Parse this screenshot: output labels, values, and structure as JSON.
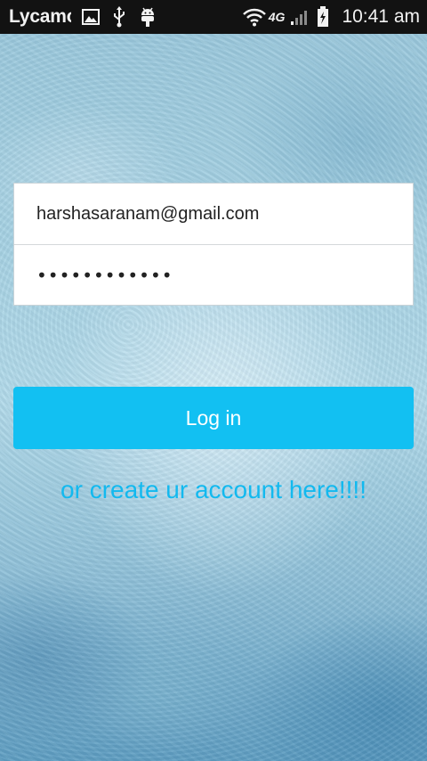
{
  "status_bar": {
    "carrier": "Lycamo",
    "network_type": "4G",
    "time": "10:41 am",
    "icons": [
      "gallery-icon",
      "usb-icon",
      "android-debug-icon",
      "wifi-icon",
      "signal-icon",
      "battery-charging-icon"
    ]
  },
  "login_form": {
    "email_value": "harshasaranam@gmail.com",
    "password_masked": "••••••••••••",
    "login_label": "Log in",
    "create_account_label": "or create ur account here!!!!"
  },
  "colors": {
    "accent": "#12c0f2",
    "link": "#12b9ef",
    "status_bar": "#121212"
  }
}
